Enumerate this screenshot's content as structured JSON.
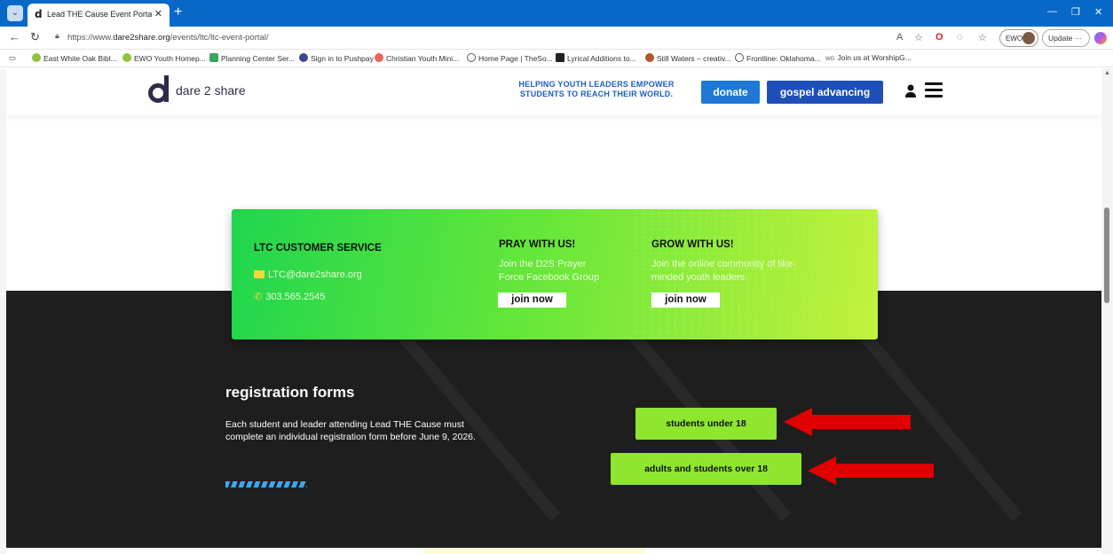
{
  "browser": {
    "tab_title": "Lead THE Cause Event Portal - Da",
    "tab_favicon": "d",
    "url_prefix": "https://www.",
    "url_domain": "dare2share.org",
    "url_path": "/events/ltc/ltc-event-portal/",
    "profile_label": "EWO",
    "update_label": "Update",
    "bookmarks": [
      "East White Oak Bibl...",
      "EWO Youth Homep...",
      "Planning Center Ser...",
      "Sign in to Pushpay",
      "Christian Youth Mini...",
      "Home Page | TheSo...",
      "Lyrical Additions to...",
      "Still Waters – creativ...",
      "Frontline: Oklahoma...",
      "Join us at WorshipG..."
    ]
  },
  "header": {
    "logo_text": "dare 2 share",
    "tagline_line1": "HELPING YOUTH LEADERS EMPOWER",
    "tagline_line2": "STUDENTS TO REACH THEIR WORLD.",
    "donate_label": "donate",
    "gospel_label": "gospel advancing"
  },
  "card": {
    "service_title": "LTC CUSTOMER SERVICE",
    "email": "LTC@dare2share.org",
    "phone": "303.565.2545",
    "pray_title": "PRAY WITH US!",
    "pray_desc_line1": "Join the D2S Prayer",
    "pray_desc_line2": "Force Facebook Group",
    "pray_button": "join now",
    "grow_title": "GROW WITH US!",
    "grow_desc_line1": "Join the online community of like-",
    "grow_desc_line2": "minded youth leaders.",
    "grow_button": "join now"
  },
  "registration": {
    "title": "registration forms",
    "desc_line1": "Each student and leader attending Lead THE Cause must",
    "desc_line2": "complete an individual registration form before June 9, 2026.",
    "students_button": "students under 18",
    "adults_button": "adults and students over 18"
  },
  "colors": {
    "brand_blue": "#1e78d6",
    "dark_blue": "#1d4fb8",
    "green_button": "#8ee62e",
    "arrow_red": "#e00000",
    "dark_bg": "#1e1e1e"
  }
}
